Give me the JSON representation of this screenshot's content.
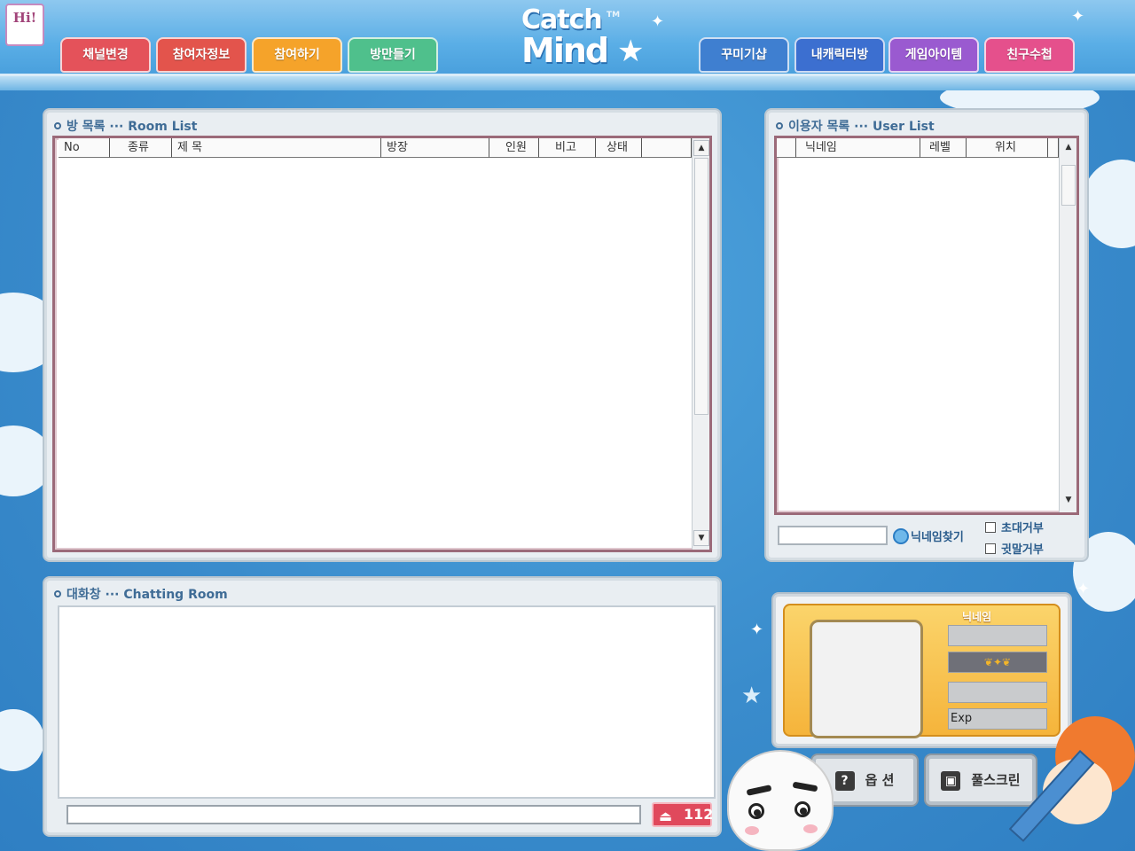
{
  "header": {
    "hi_logo": "Hi!",
    "tabs": [
      {
        "label": "채널변경",
        "color": "#e4525a"
      },
      {
        "label": "참여자정보",
        "color": "#e3544c"
      },
      {
        "label": "참여하기",
        "color": "#f5a32a"
      },
      {
        "label": "방만들기",
        "color": "#4fc08c"
      },
      {
        "label": "꾸미기샵",
        "color": "#3f7fd0"
      },
      {
        "label": "내캐릭터방",
        "color": "#3c6fd0"
      },
      {
        "label": "게임아이템",
        "color": "#9a5ad0"
      },
      {
        "label": "친구수첩",
        "color": "#e5508c"
      }
    ],
    "logo_line1": "Catch",
    "logo_line2": "Mind",
    "logo_tm": "TM"
  },
  "room_list": {
    "title": "방 목록 ··· Room List",
    "columns": [
      "No",
      "종류",
      "제   목",
      "방장",
      "인원",
      "비고",
      "상태"
    ]
  },
  "user_list": {
    "title": "이용자 목록 ··· User List",
    "columns": [
      "닉네임",
      "레벨",
      "위치"
    ],
    "search_label": "닉네임찾기",
    "invite_refuse": "초대거부",
    "whisper_refuse": "귓말거부"
  },
  "chat": {
    "title": "대화창 ··· Chatting Room",
    "badge_count": "112"
  },
  "profile": {
    "nick_label": "닉네임",
    "exp_label": "Exp"
  },
  "buttons": {
    "options": "옵   션",
    "fullscreen": "풀스크린"
  }
}
